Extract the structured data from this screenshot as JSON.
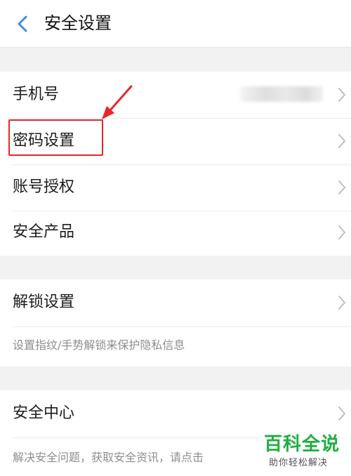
{
  "header": {
    "title": "安全设置"
  },
  "group1": {
    "items": [
      {
        "label": "手机号"
      },
      {
        "label": "密码设置"
      },
      {
        "label": "账号授权"
      },
      {
        "label": "安全产品"
      }
    ]
  },
  "group2": {
    "item": {
      "label": "解锁设置"
    },
    "note": "设置指纹/手势解锁来保护隐私信息"
  },
  "group3": {
    "item": {
      "label": "安全中心"
    },
    "note": "解决安全问题，获取安全资讯，请点击"
  },
  "watermark": {
    "main": "百科全说",
    "sub": "助你轻松解决"
  },
  "colors": {
    "background": "#f2f2f2",
    "accent": "#3d8fe0",
    "highlight": "#e8262a",
    "watermark": "#1fae3f"
  }
}
